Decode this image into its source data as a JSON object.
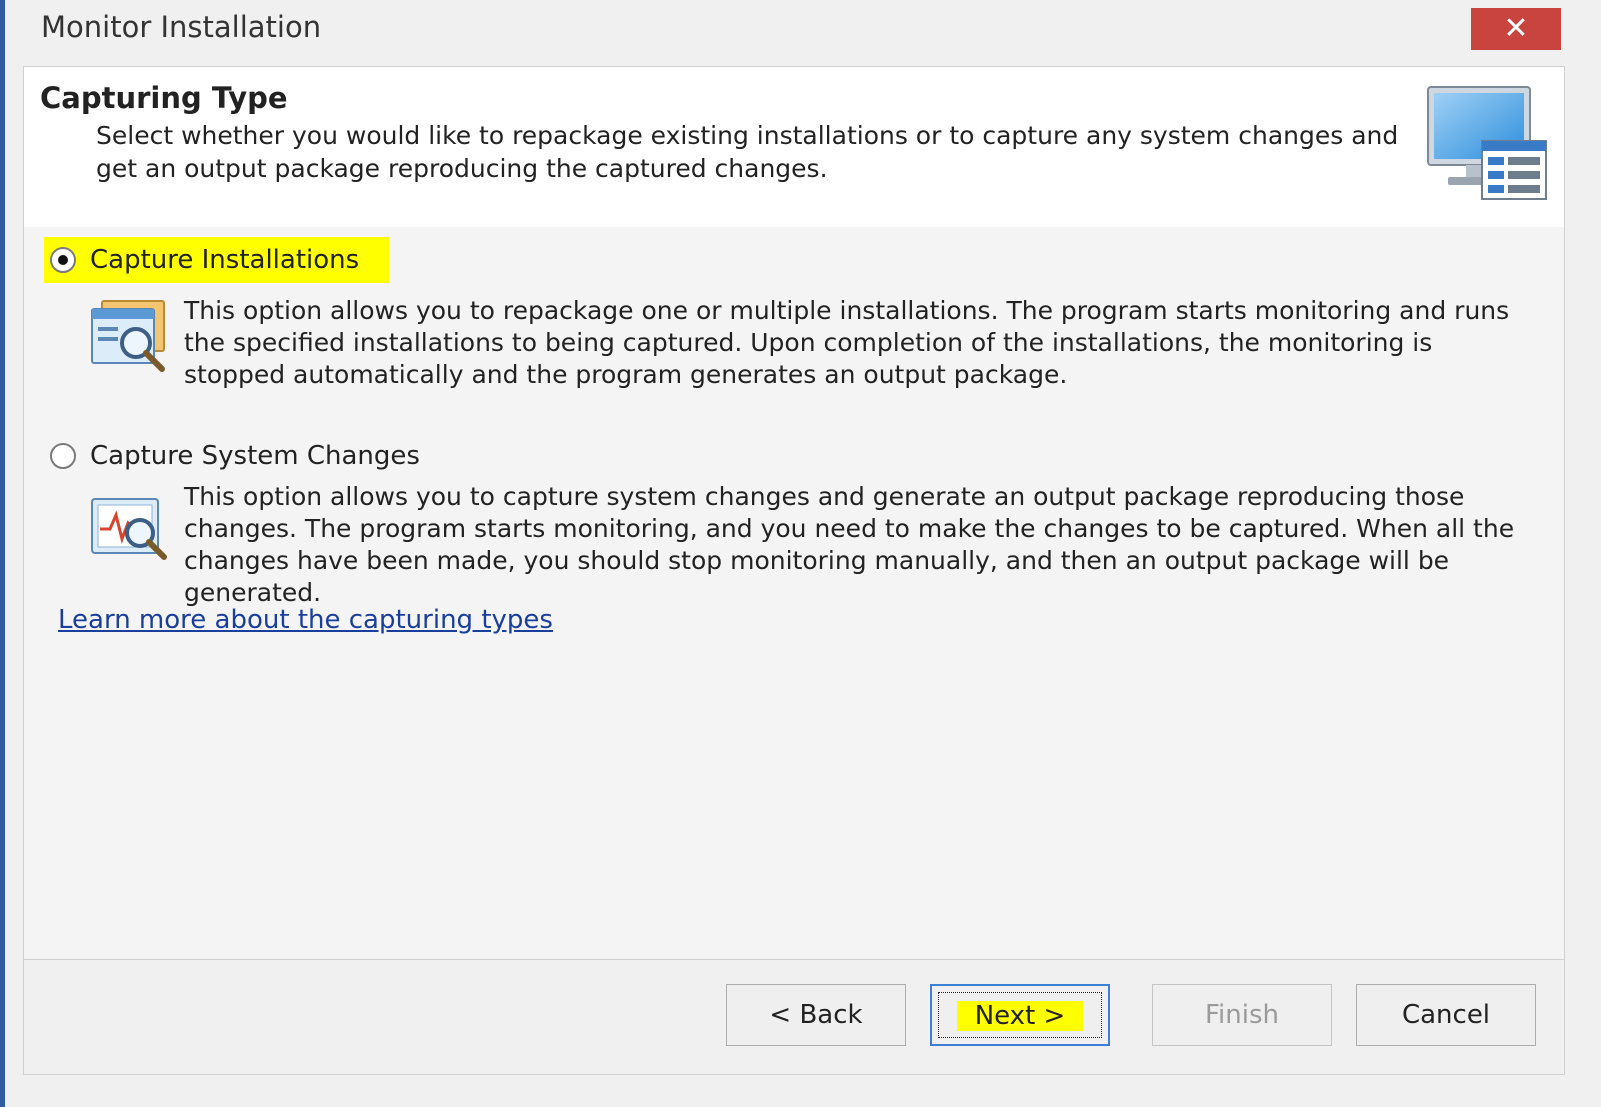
{
  "window": {
    "title": "Monitor Installation",
    "close_symbol": "✕"
  },
  "header": {
    "title": "Capturing Type",
    "description": "Select whether you would like to repackage existing installations or to capture any system changes and get an output package reproducing the captured changes.",
    "icon": "monitor-window-icon"
  },
  "options": [
    {
      "label": "Capture Installations",
      "selected": true,
      "highlighted": true,
      "icon": "installation-search-icon",
      "description": "This option allows you to repackage one or multiple installations. The program starts monitoring and runs the specified installations to being captured. Upon completion of the installations, the monitoring is stopped automatically and the program generates an output package."
    },
    {
      "label": "Capture System Changes",
      "selected": false,
      "highlighted": false,
      "icon": "system-monitor-search-icon",
      "description": "This option allows you to capture system changes and generate an output package reproducing those changes. The program starts monitoring, and you need to make the changes to be captured. When all the changes have been made, you should stop monitoring manually, and then an output package will be generated."
    }
  ],
  "learn_more_link": "Learn more about the capturing types",
  "footer": {
    "back_label": "< Back",
    "next_label": "Next >",
    "finish_label": "Finish",
    "cancel_label": "Cancel",
    "finish_disabled": true,
    "next_highlighted": true
  },
  "colors": {
    "highlight": "#ffff00",
    "close_button": "#c9433f",
    "link": "#1a3e9c",
    "focus_border": "#3c7fd6"
  }
}
